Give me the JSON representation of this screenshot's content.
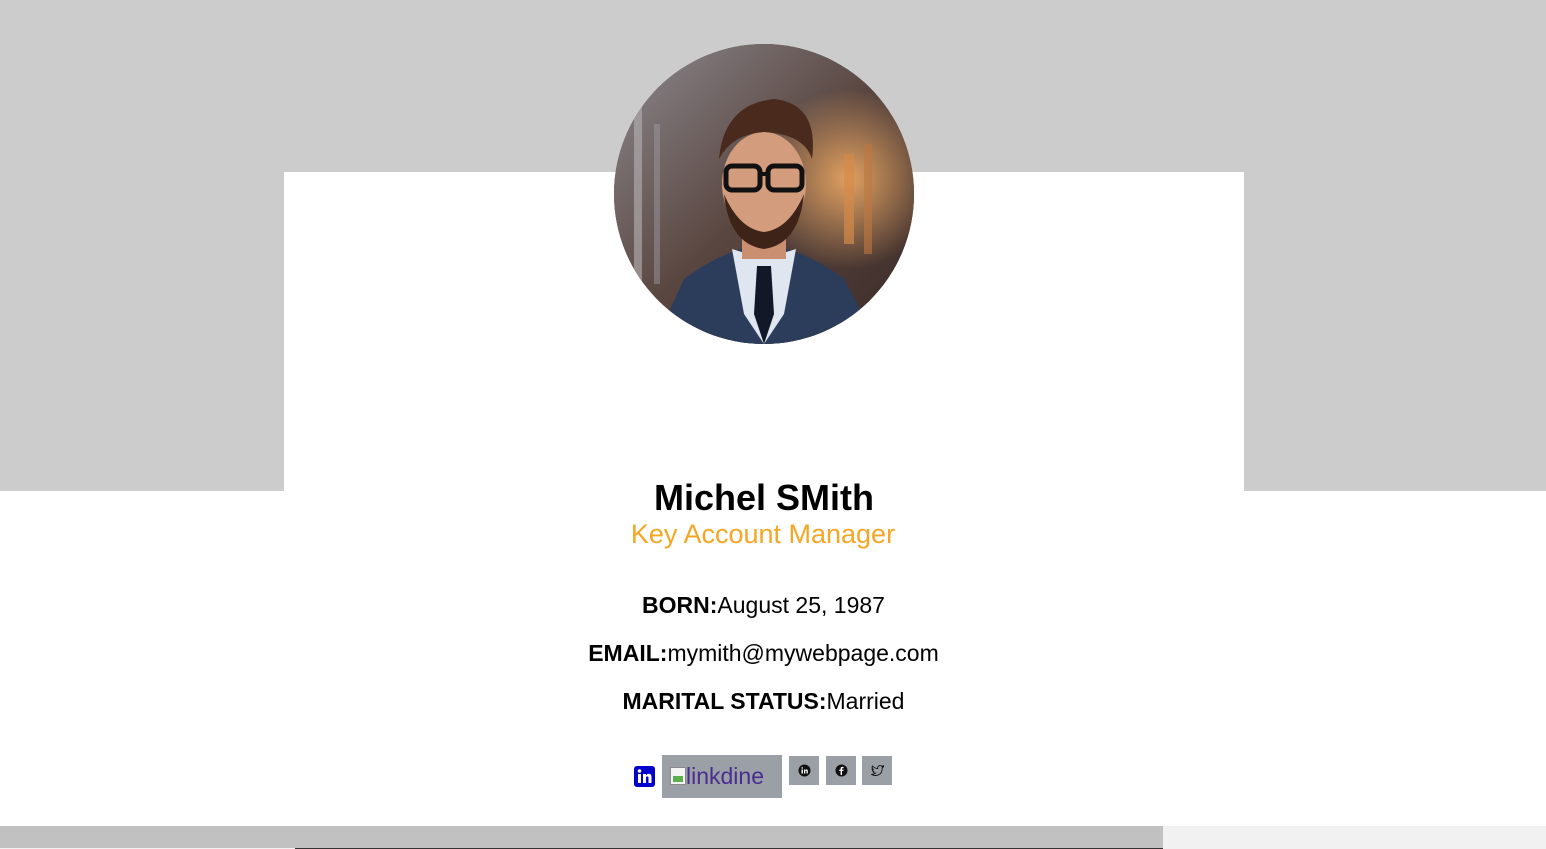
{
  "profile": {
    "name": "Michel SMith",
    "job_title": "Key Account Manager",
    "avatar_icon": "profile-photo"
  },
  "details": {
    "born_label": "BORN:",
    "born_value": "August 25, 1987",
    "email_label": "EMAIL:",
    "email_value": "mymith@mywebpage.com",
    "marital_label": "MARITAL STATUS:",
    "marital_value": "Married"
  },
  "social": {
    "linkedin_icon": "linkedin-icon",
    "broken_image_alt": "linkdine",
    "buttons": [
      {
        "icon": "linkedin-icon"
      },
      {
        "icon": "facebook-icon"
      },
      {
        "icon": "twitter-icon"
      }
    ]
  },
  "colors": {
    "background_band": "#cccccc",
    "accent": "#f5a623",
    "linkedin_blue": "#0000cc",
    "button_gray": "#9aa0a6"
  },
  "scrollbar": {
    "position": 0.75
  }
}
